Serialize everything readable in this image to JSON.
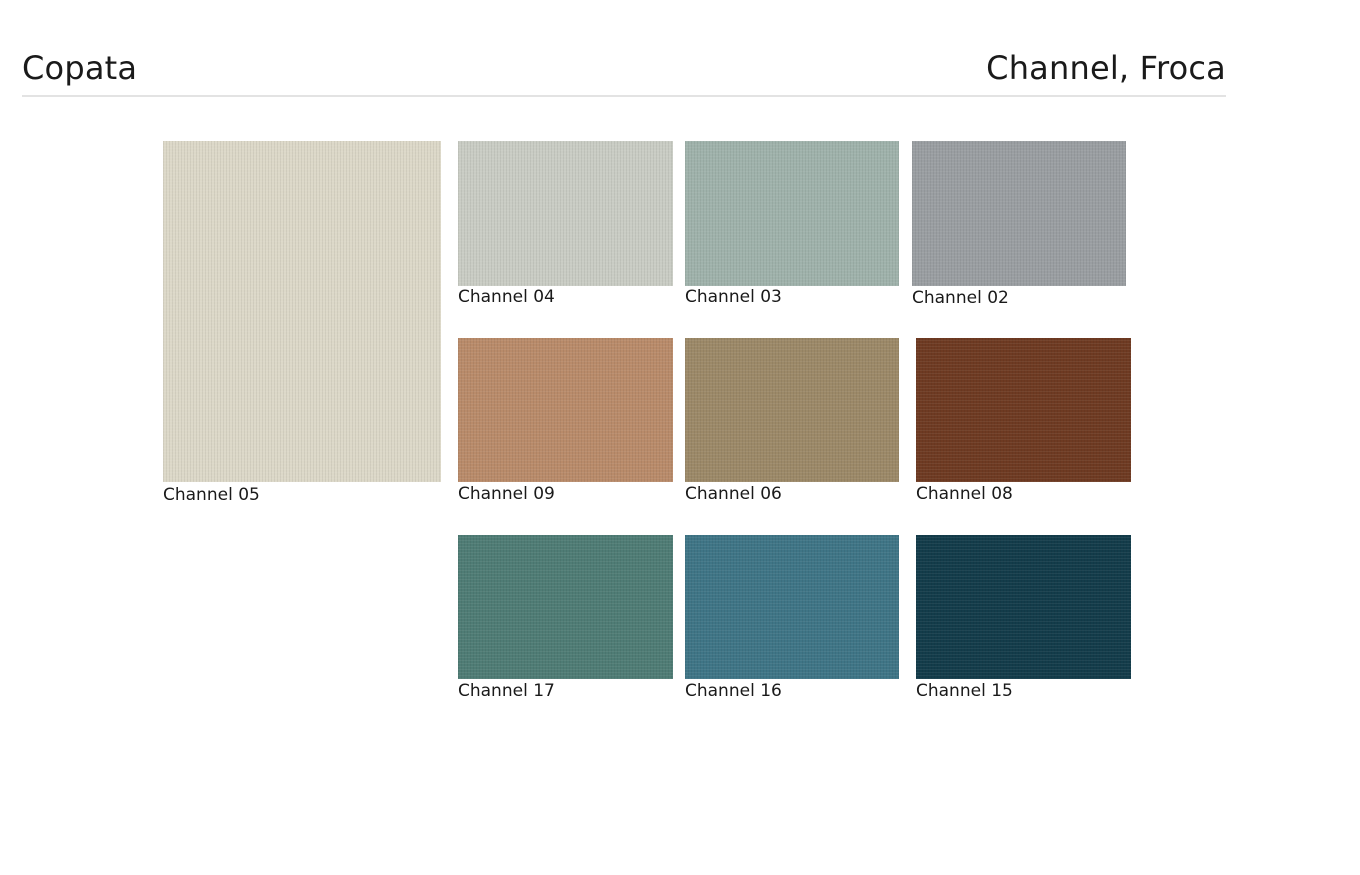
{
  "header": {
    "left_title": "Copata",
    "right_title": "Channel, Froca"
  },
  "swatches": [
    {
      "name": "Channel 05",
      "color": "#dcd8c8"
    },
    {
      "name": "Channel 04",
      "color": "#c9ccc4"
    },
    {
      "name": "Channel 03",
      "color": "#9fb2ab"
    },
    {
      "name": "Channel 02",
      "color": "#9a9ea2"
    },
    {
      "name": "Channel 09",
      "color": "#b98b6a"
    },
    {
      "name": "Channel 06",
      "color": "#9c8968"
    },
    {
      "name": "Channel 08",
      "color": "#6e3a22"
    },
    {
      "name": "Channel 17",
      "color": "#4f7c75"
    },
    {
      "name": "Channel 16",
      "color": "#3f7586"
    },
    {
      "name": "Channel 15",
      "color": "#133c4a"
    }
  ]
}
